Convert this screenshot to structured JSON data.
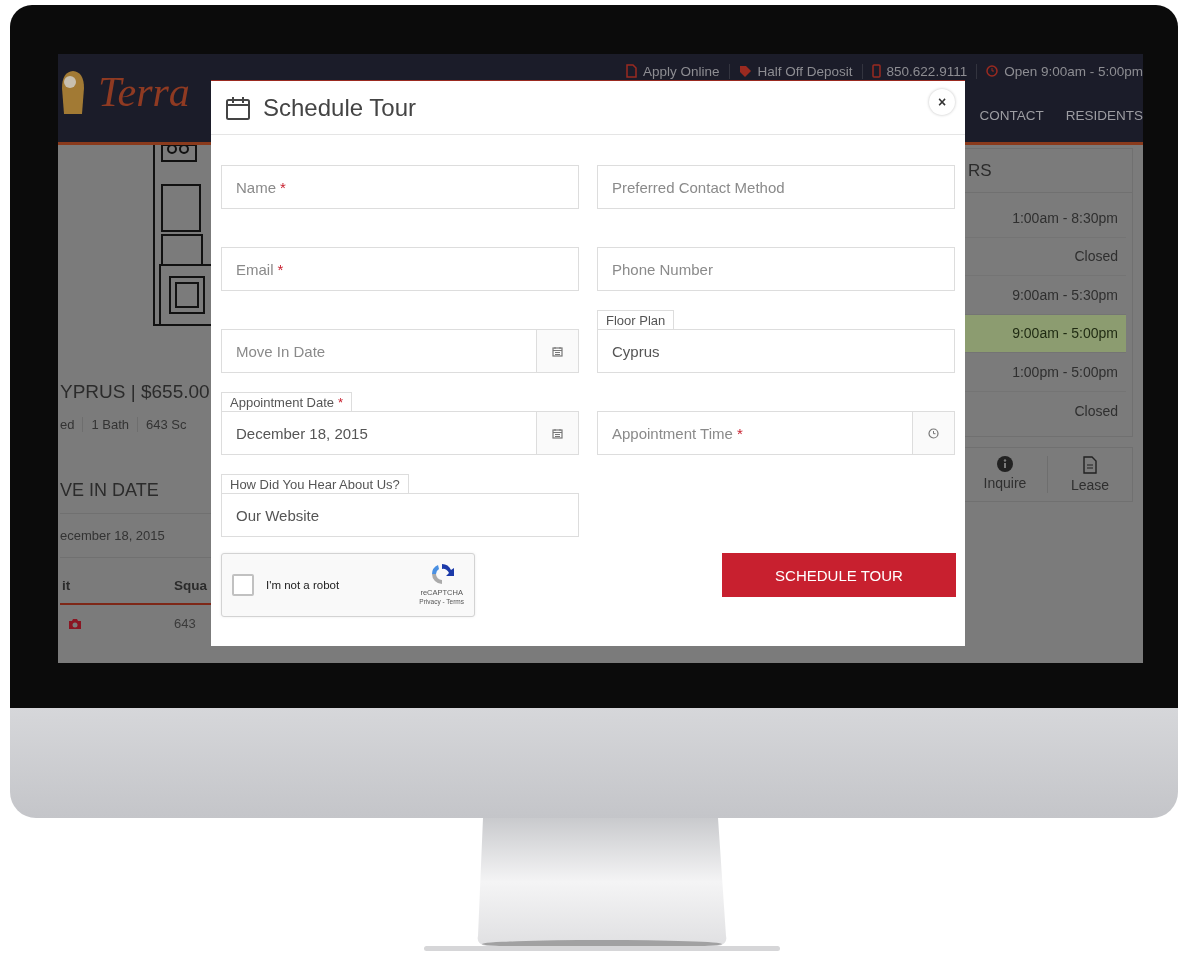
{
  "header": {
    "logo": "Terra",
    "top_links": [
      {
        "label": "Apply Online"
      },
      {
        "label": "Half Off Deposit"
      },
      {
        "label": "850.622.9111"
      },
      {
        "label": "Open 9:00am - 5:00pm"
      }
    ],
    "nav": [
      "CONTACT",
      "RESIDENTS"
    ]
  },
  "unit": {
    "title": "YPRUS | $655.00",
    "specs": [
      "ed",
      "1 Bath",
      "643 Sc"
    ],
    "move_in_heading": "VE IN DATE",
    "move_in_date": "ecember 18, 2015",
    "table": {
      "columns": [
        "it",
        "Squa"
      ],
      "rows": [
        {
          "photo": true,
          "column_2": "643"
        }
      ]
    }
  },
  "hours": {
    "heading": "RS",
    "rows": [
      {
        "hours": "1:00am - 8:30pm",
        "selected": false
      },
      {
        "hours": "Closed",
        "selected": false
      },
      {
        "hours": "9:00am - 5:30pm",
        "selected": false
      },
      {
        "hours": "9:00am - 5:00pm",
        "selected": true
      },
      {
        "hours": "1:00pm - 5:00pm",
        "selected": false
      },
      {
        "hours": "Closed",
        "selected": false
      }
    ],
    "actions": [
      {
        "label": "Inquire"
      },
      {
        "label": "Lease"
      }
    ]
  },
  "modal": {
    "title": "Schedule Tour",
    "close": "×",
    "rows": [
      [
        {
          "kind": "text",
          "placeholder": "Name",
          "required_mark": "*"
        },
        {
          "kind": "text",
          "placeholder": "Preferred Contact Method"
        }
      ],
      [
        {
          "kind": "text",
          "placeholder": "Email",
          "required_mark": "*"
        },
        {
          "kind": "text",
          "placeholder": "Phone Number"
        }
      ],
      [
        {
          "kind": "date",
          "placeholder": "Move In Date"
        },
        {
          "kind": "text",
          "label": "Floor Plan",
          "value": "Cyprus"
        }
      ],
      [
        {
          "kind": "date",
          "label": "Appointment Date",
          "required_mark": "*",
          "value": "December 18, 2015"
        },
        {
          "kind": "time",
          "placeholder": "Appointment Time",
          "required_mark": "*"
        }
      ],
      [
        {
          "kind": "text",
          "label": "How Did You Hear About Us?",
          "value": "Our Website"
        }
      ]
    ],
    "captcha": {
      "label": "I'm not a robot",
      "checked": false,
      "brand": "reCAPTCHA",
      "links": "Privacy - Terms"
    },
    "submit": "SCHEDULE TOUR"
  }
}
